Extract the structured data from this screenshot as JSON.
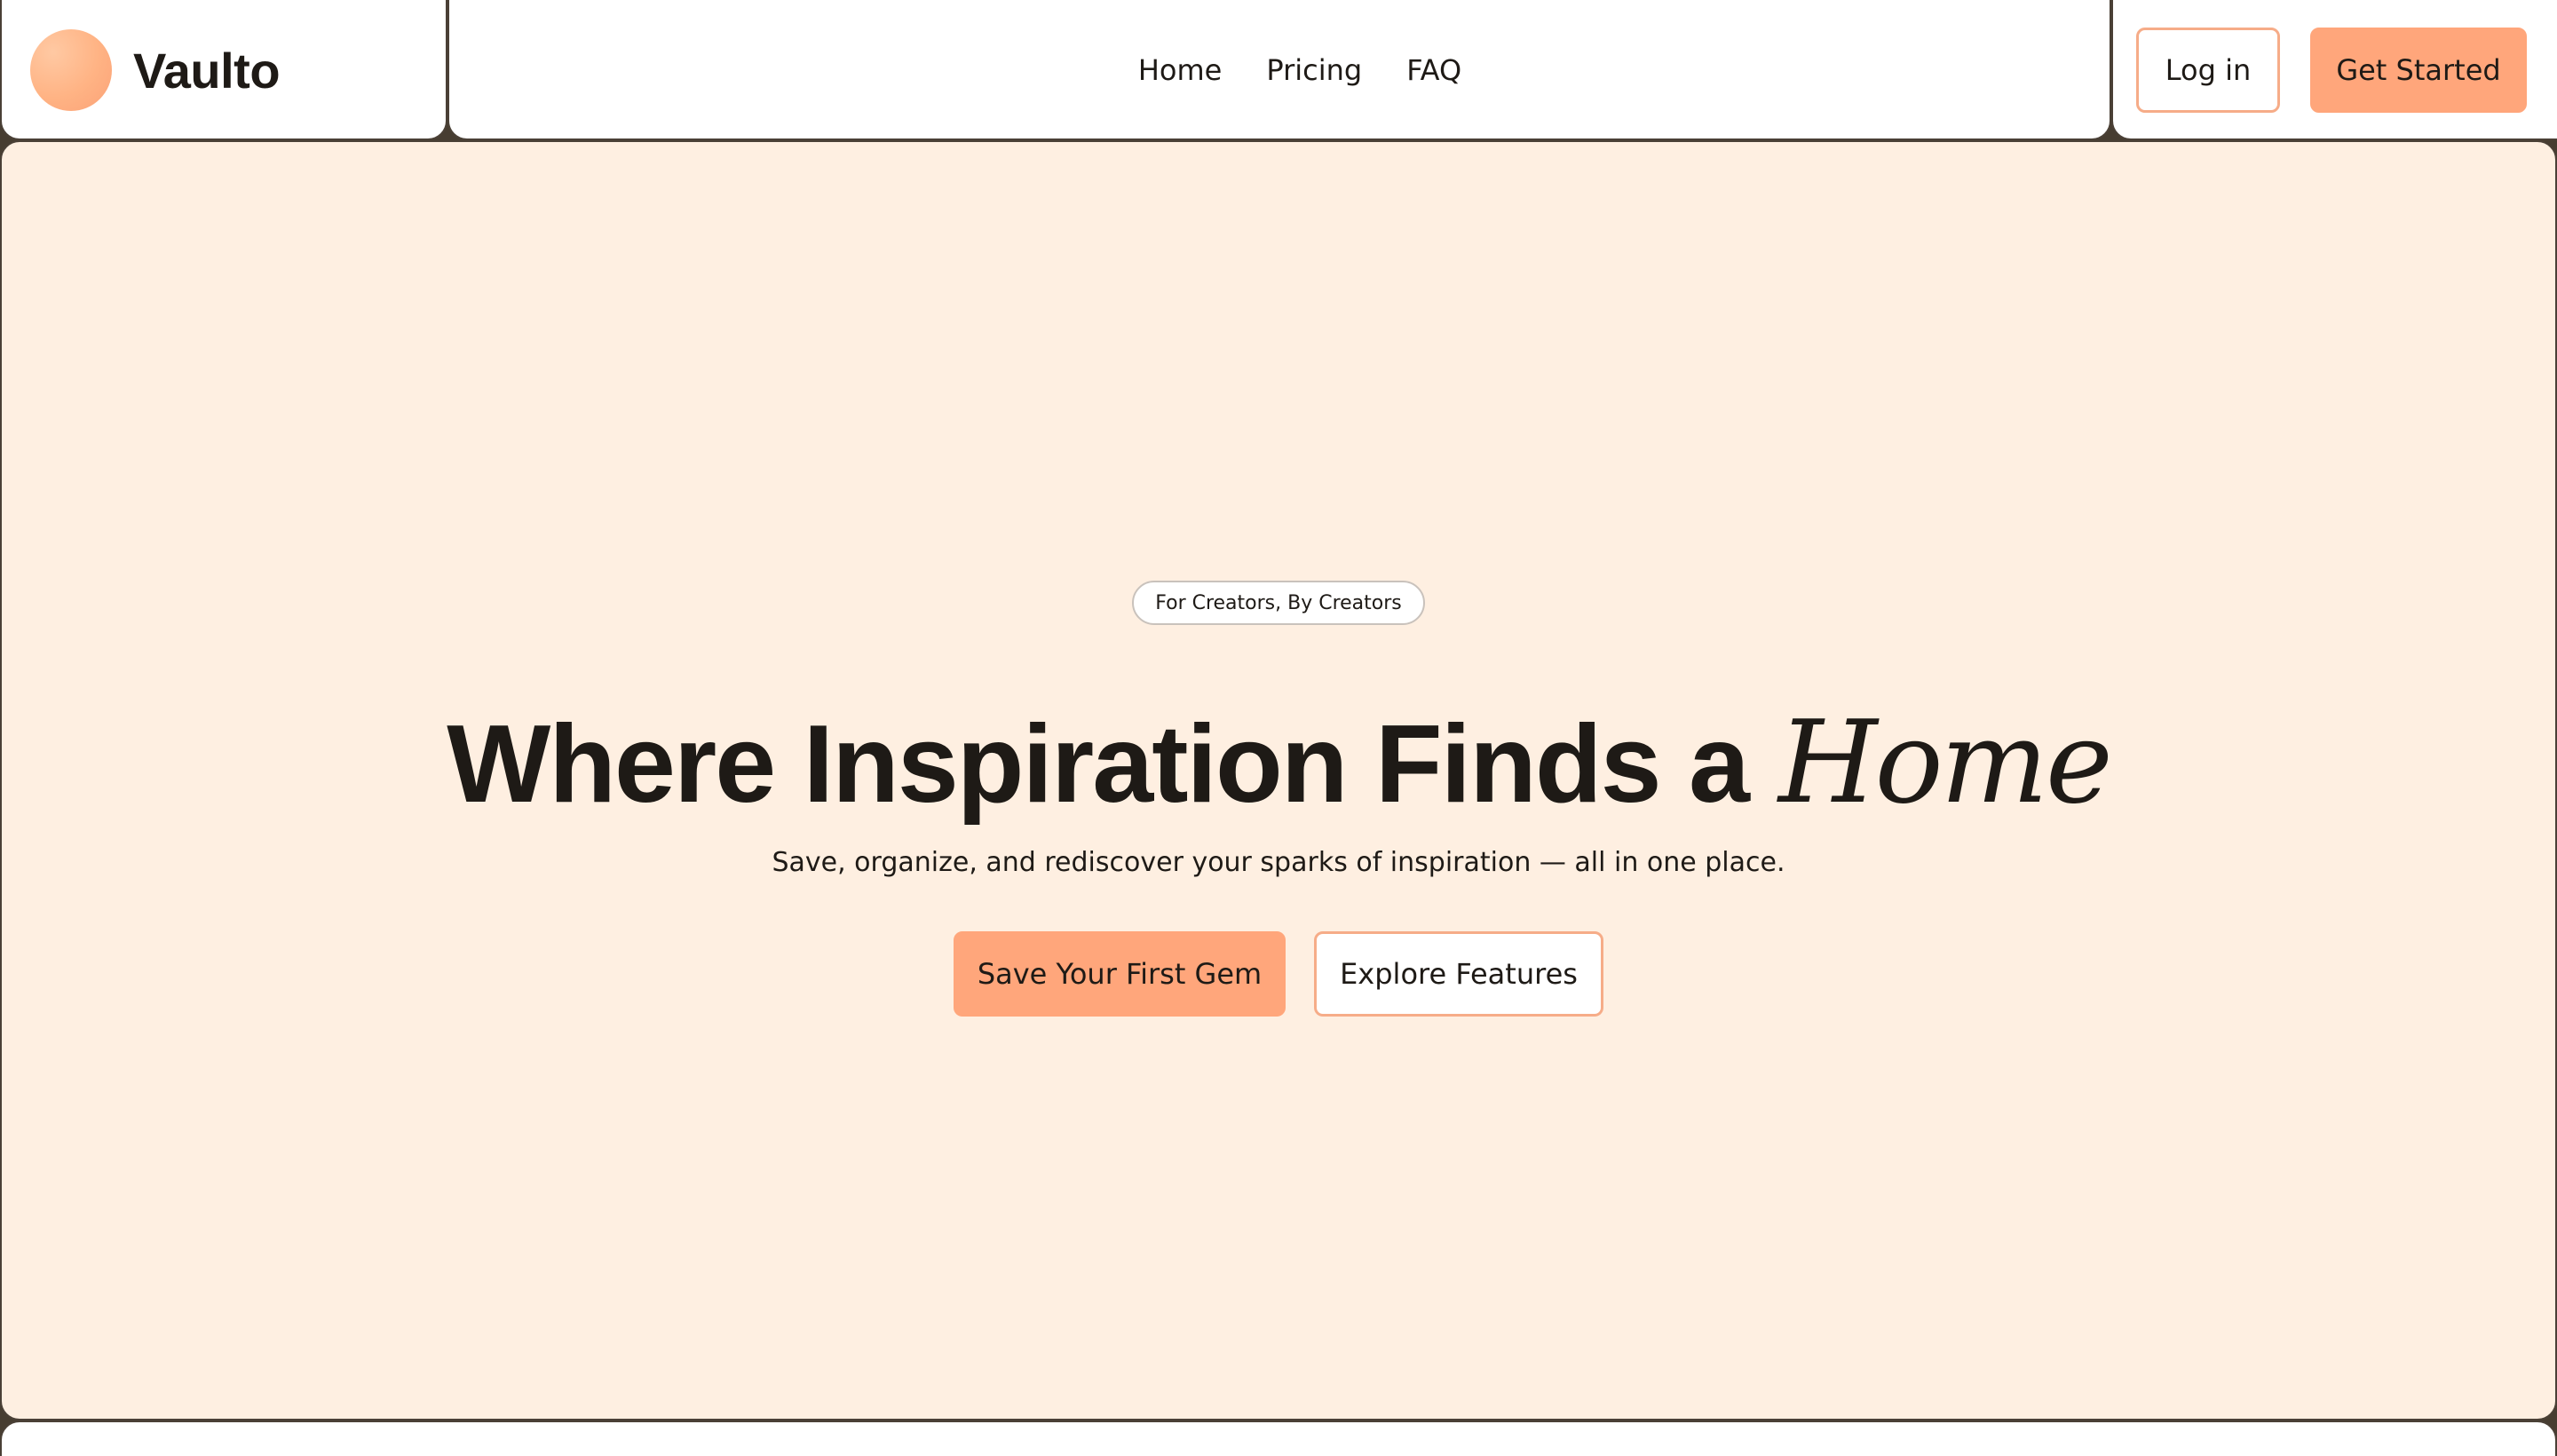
{
  "brand": {
    "name": "Vaulto",
    "logo_icon": "gradient-circle-logo",
    "logo_colors": [
      "#ffc9a3",
      "#fba277"
    ]
  },
  "nav": {
    "items": [
      {
        "label": "Home"
      },
      {
        "label": "Pricing"
      },
      {
        "label": "FAQ"
      }
    ]
  },
  "header_actions": {
    "login_label": "Log in",
    "get_started_label": "Get Started"
  },
  "hero": {
    "badge": "For Creators, By Creators",
    "headline": "Where Inspiration Finds a",
    "headline_accent": "Home",
    "subheadline": "Save, organize, and rediscover your sparks of inspiration — all in one place.",
    "primary_cta": "Save Your First Gem",
    "secondary_cta": "Explore Features"
  },
  "colors": {
    "accent": "#ffa67b",
    "accent_border": "#f6ac88",
    "hero_background": "#feefe1",
    "page_background": "#473d31",
    "text": "#1e1a16"
  }
}
